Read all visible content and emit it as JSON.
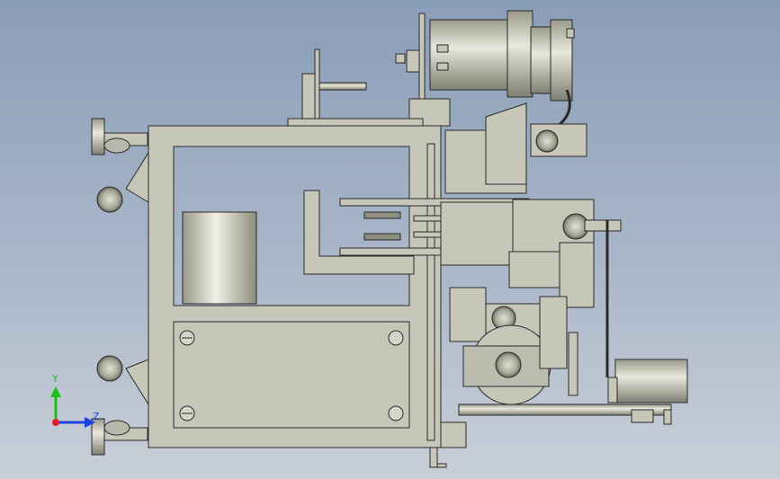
{
  "viewport": {
    "name": "cad-3d-viewport",
    "background_top": "#8a9db8",
    "background_bottom": "#c9cfd8"
  },
  "triad": {
    "y_label": "Y",
    "z_label": "Z",
    "y_color": "#1ec01e",
    "z_color": "#2040e0",
    "x_color": "#e02020"
  },
  "part_color": "#c6c7b8"
}
